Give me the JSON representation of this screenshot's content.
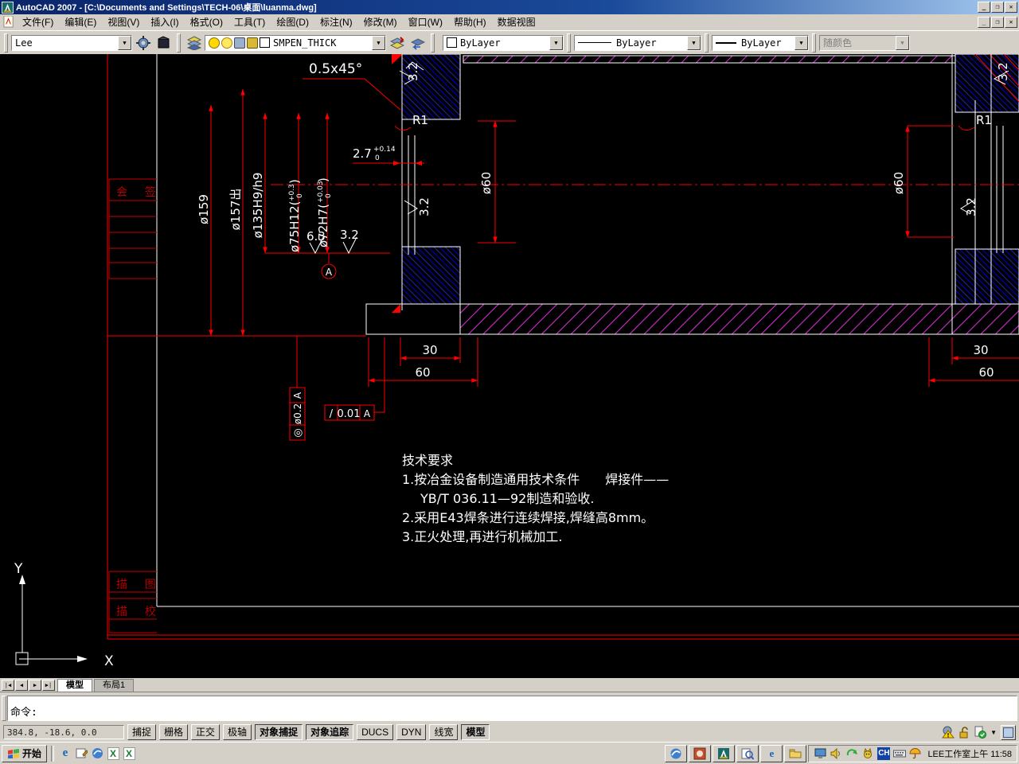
{
  "window": {
    "title": "AutoCAD 2007 - [C:\\Documents and Settings\\TECH-06\\桌面\\luanma.dwg]",
    "controls": {
      "minimize": "_",
      "maximize": "❐",
      "close": "✕"
    }
  },
  "menu": {
    "items": [
      "文件(F)",
      "编辑(E)",
      "视图(V)",
      "插入(I)",
      "格式(O)",
      "工具(T)",
      "绘图(D)",
      "标注(N)",
      "修改(M)",
      "窗口(W)",
      "帮助(H)",
      "数据视图"
    ]
  },
  "toolbar": {
    "workspace_combo": "Lee",
    "layer_combo": "SMPEN_THICK",
    "color_combo": "ByLayer",
    "linetype_combo": "ByLayer",
    "lineweight_combo": "ByLayer",
    "plotstyle_combo": "随颜色"
  },
  "drawing": {
    "chamfer_label": "0.5x45°",
    "fillet_label": "R1",
    "dia159": "ø159",
    "dia157": "ø157出",
    "dia135": "ø135H9/h9",
    "dia75": {
      "label": "ø75H12(",
      "upper": "+0.3",
      "lower": "0",
      "close": ")"
    },
    "dia72": {
      "label": "ø72H7(",
      "upper": "+0.03",
      "lower": "0",
      "close": ")"
    },
    "dim27": {
      "label": "2.7",
      "upper": "+0.14",
      "lower": "0"
    },
    "dia60": "ø60",
    "rough_63": "6.3",
    "rough_32": "3.2",
    "datum_label": "A",
    "fcf_vertical": {
      "symbol": "◎",
      "value": "ø0.2",
      "datum": "A"
    },
    "fcf_horizontal": {
      "symbol": "/",
      "value": "0.01",
      "datum": "A"
    },
    "dim30": "30",
    "dim60": "60",
    "tech_req": {
      "title": "技术要求",
      "line1": "1.按冶金设备制造通用技术条件　　焊接件——",
      "line2": "YB/T  036.11—92制造和验收.",
      "line3": "2.采用E43焊条进行连续焊接,焊缝高8mm。",
      "line4": "3.正火处理,再进行机械加工."
    },
    "titleblock": {
      "huiqian": "会 签",
      "miaotu": "描 图",
      "miaojiao": "描 校"
    },
    "ucs": {
      "x": "X",
      "y": "Y"
    }
  },
  "tabs": {
    "model": "模型",
    "layout1": "布局1"
  },
  "command": {
    "prompt": "命令:"
  },
  "statusbar": {
    "coords": "384.8, -18.6, 0.0",
    "buttons": [
      {
        "label": "捕捉",
        "pressed": false
      },
      {
        "label": "栅格",
        "pressed": false
      },
      {
        "label": "正交",
        "pressed": false
      },
      {
        "label": "极轴",
        "pressed": false
      },
      {
        "label": "对象捕捉",
        "pressed": true
      },
      {
        "label": "对象追踪",
        "pressed": true
      },
      {
        "label": "DUCS",
        "pressed": false
      },
      {
        "label": "DYN",
        "pressed": false
      },
      {
        "label": "线宽",
        "pressed": false
      },
      {
        "label": "模型",
        "pressed": true
      }
    ]
  },
  "taskbar": {
    "start": "开始",
    "ime": "CH",
    "clock": "LEE工作室上午 11:58"
  },
  "colors": {
    "dim_red": "#ff0000",
    "hatch_blue": "#0000b8",
    "hatch_magenta": "#cf2fcf",
    "canvas_bg": "#000000",
    "titlebar_blue": "#0a246a"
  }
}
